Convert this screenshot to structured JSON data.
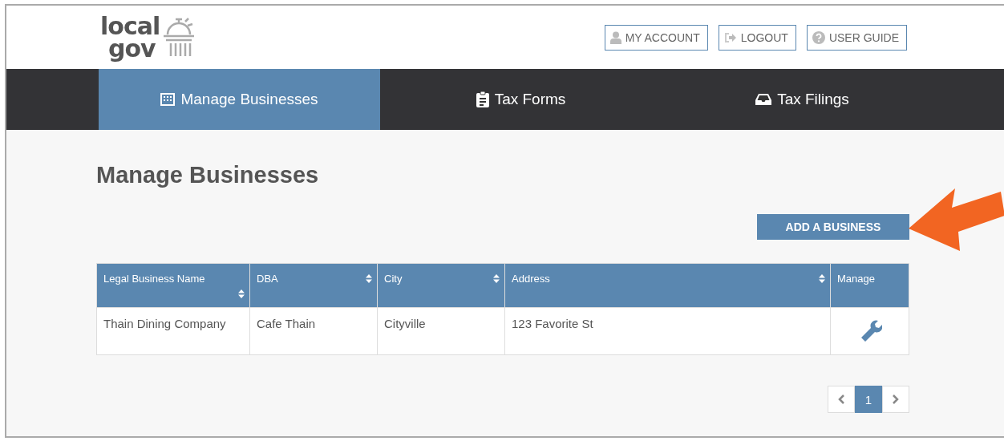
{
  "logo": {
    "line_1": "local",
    "line_2": "gov"
  },
  "header_links": [
    {
      "label": "MY ACCOUNT",
      "kind": "account"
    },
    {
      "label": "LOGOUT",
      "kind": "logout"
    },
    {
      "label": "USER GUIDE",
      "kind": "guide"
    }
  ],
  "nav": [
    {
      "label": "Manage Businesses",
      "kind": "building",
      "selected": true
    },
    {
      "label": "Tax Forms",
      "kind": "clipboard",
      "selected": false
    },
    {
      "label": "Tax Filings",
      "kind": "inbox",
      "selected": false
    }
  ],
  "page_title": "Manage Businesses",
  "add_button": "ADD A BUSINESS",
  "table": {
    "columns": [
      {
        "label": "Legal Business Name",
        "sortable": true
      },
      {
        "label": "DBA",
        "sortable": true
      },
      {
        "label": "City",
        "sortable": true
      },
      {
        "label": "Address",
        "sortable": true
      },
      {
        "label": "Manage",
        "sortable": false
      }
    ],
    "rows": [
      {
        "legal_name": "Thain Dining Company",
        "dba": "Cafe Thain",
        "city": "Cityville",
        "address": "123 Favorite St"
      }
    ]
  },
  "pagination": {
    "pages": [
      {
        "label": "1",
        "selected": true
      }
    ]
  }
}
